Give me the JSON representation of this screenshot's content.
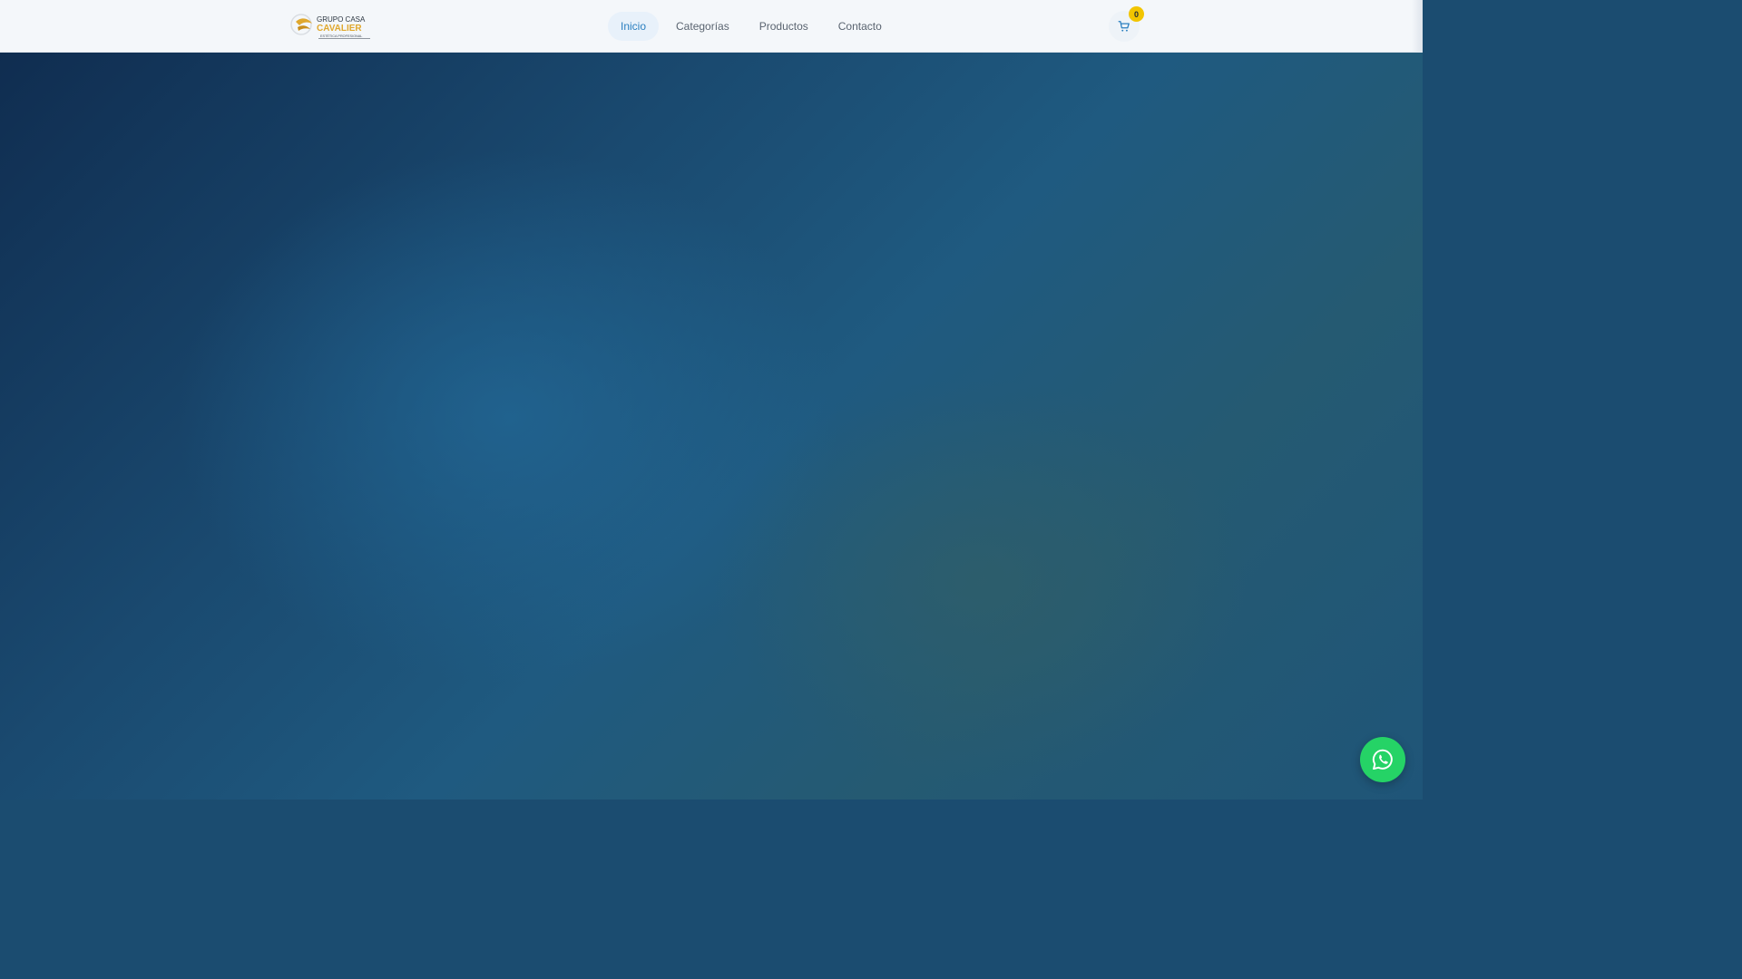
{
  "brand": {
    "line1": "GRUPO CASA",
    "line2": "CAVALIER",
    "line3": "ESTÉTICA PROFESIONAL"
  },
  "nav": {
    "items": [
      {
        "label": "Inicio",
        "active": true
      },
      {
        "label": "Categorías",
        "active": false
      },
      {
        "label": "Productos",
        "active": false
      },
      {
        "label": "Contacto",
        "active": false
      }
    ]
  },
  "cart": {
    "icon": "shopping-cart-icon",
    "count": "0"
  },
  "whatsapp": {
    "icon": "whatsapp-icon"
  },
  "colors": {
    "accent": "#2a7fc0",
    "badge": "#f2c500",
    "whatsapp": "#25d366",
    "header_bg": "#f4f7fa",
    "hero_dark": "#0f2b4e",
    "hero_mid": "#1f5a80"
  }
}
